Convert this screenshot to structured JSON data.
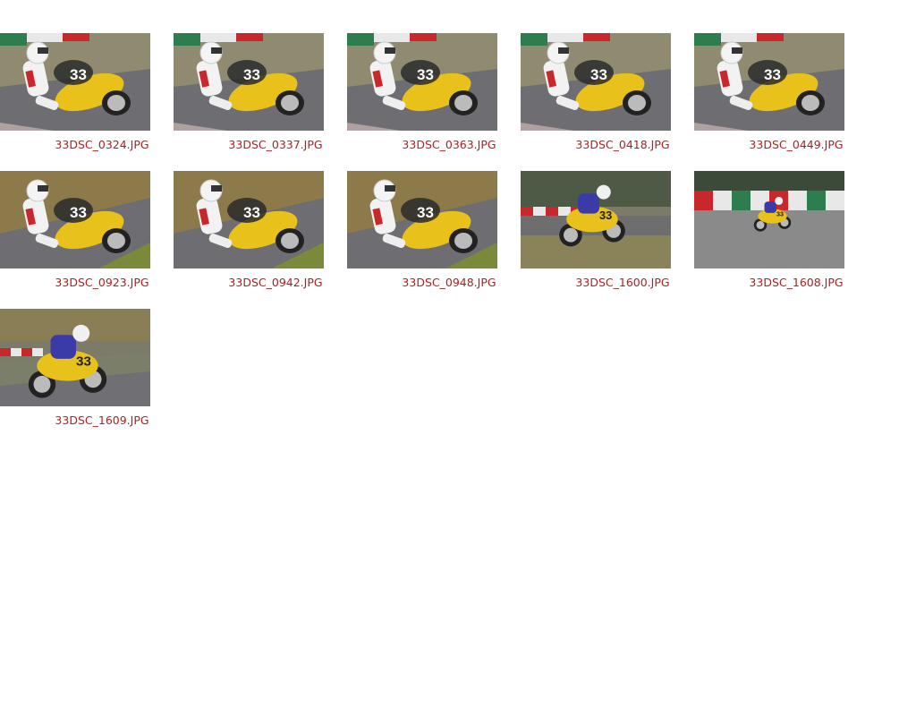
{
  "gallery": {
    "items": [
      {
        "filename": "33DSC_0324.JPG",
        "variant": "lean-close"
      },
      {
        "filename": "33DSC_0337.JPG",
        "variant": "lean-close"
      },
      {
        "filename": "33DSC_0363.JPG",
        "variant": "lean-close"
      },
      {
        "filename": "33DSC_0418.JPG",
        "variant": "lean-close"
      },
      {
        "filename": "33DSC_0449.JPG",
        "variant": "lean-close"
      },
      {
        "filename": "33DSC_0923.JPG",
        "variant": "lean-grass"
      },
      {
        "filename": "33DSC_0942.JPG",
        "variant": "lean-grass"
      },
      {
        "filename": "33DSC_0948.JPG",
        "variant": "lean-grass"
      },
      {
        "filename": "33DSC_1600.JPG",
        "variant": "upright-blue"
      },
      {
        "filename": "33DSC_1608.JPG",
        "variant": "far-blue"
      },
      {
        "filename": "33DSC_1609.JPG",
        "variant": "mid-blue"
      }
    ]
  },
  "colors": {
    "caption": "#b71c1c",
    "bike_yellow": "#e8c21a",
    "track": "#6e6e72",
    "grass": "#8a8a62",
    "curb_red": "#c8282c",
    "curb_green": "#2e7d4f"
  }
}
